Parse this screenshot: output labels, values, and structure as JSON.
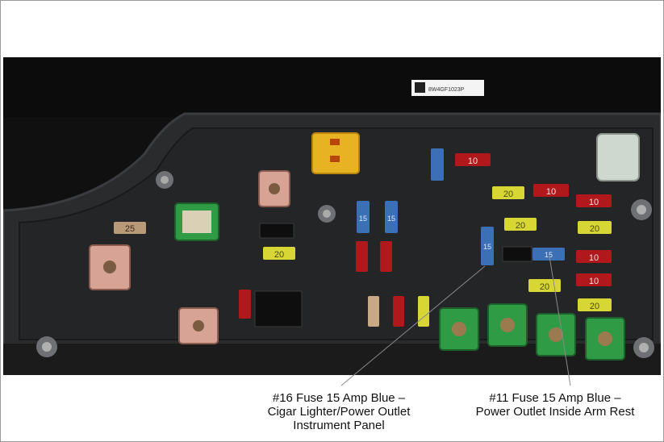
{
  "photo": {
    "label_sticker": "8W4GF1023P",
    "fuses": [
      {
        "text": "25",
        "color": "#b89a78"
      },
      {
        "text": "10",
        "color": "#b0181c"
      },
      {
        "text": "10",
        "color": "#b0181c"
      },
      {
        "text": "10",
        "color": "#b0181c"
      },
      {
        "text": "10",
        "color": "#b0181c"
      },
      {
        "text": "10",
        "color": "#b0181c"
      },
      {
        "text": "20",
        "color": "#d7d634"
      },
      {
        "text": "20",
        "color": "#d7d634"
      },
      {
        "text": "20",
        "color": "#d7d634"
      },
      {
        "text": "20",
        "color": "#d7d634"
      },
      {
        "text": "20",
        "color": "#d7d634"
      },
      {
        "text": "20",
        "color": "#d7d634"
      },
      {
        "text": "15",
        "color": "#3b6fb6"
      },
      {
        "text": "15",
        "color": "#3b6fb6"
      },
      {
        "text": "15",
        "color": "#3b6fb6"
      },
      {
        "text": "15",
        "color": "#3b6fb6"
      }
    ]
  },
  "callouts": {
    "left": {
      "line1": "#16 Fuse 15 Amp Blue –",
      "line2": "Cigar Lighter/Power Outlet",
      "line3": "Instrument Panel"
    },
    "right": {
      "line1": "#11 Fuse 15 Amp Blue –",
      "line2": "Power Outlet Inside Arm Rest"
    }
  }
}
